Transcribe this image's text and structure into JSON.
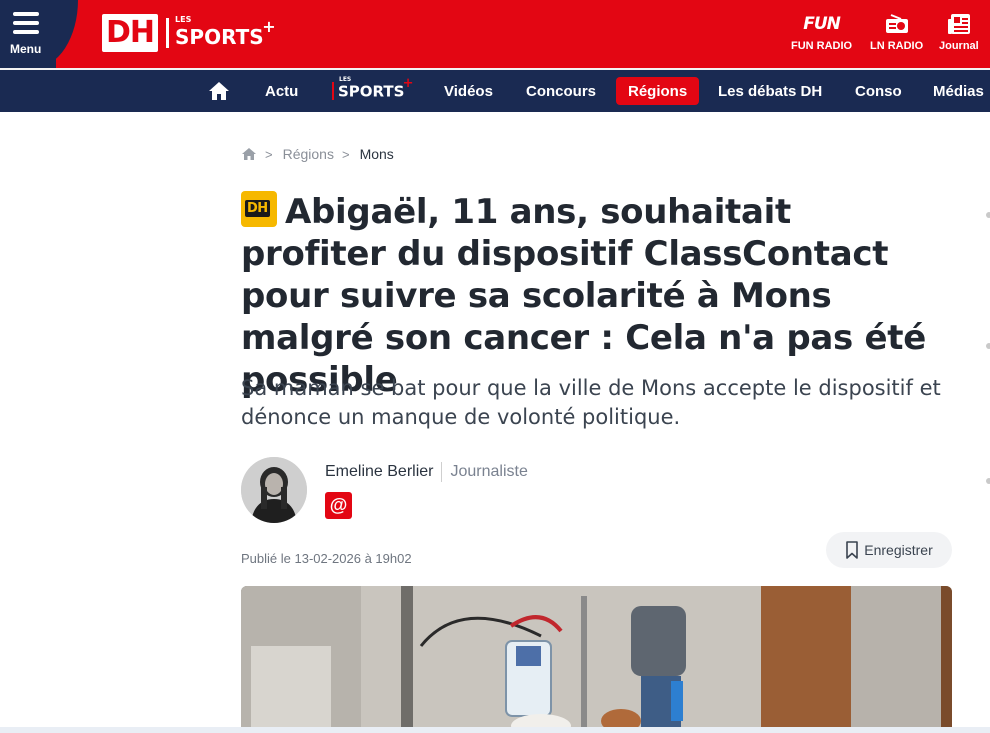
{
  "header": {
    "menu_label": "Menu",
    "logo_dh": "DH",
    "logo_les": "LES",
    "logo_sports": "SPORTS",
    "logo_plus": "+",
    "quick_links": [
      {
        "label": "FUN RADIO",
        "icon": "fun-radio-logo-icon",
        "icon_text": "FUN"
      },
      {
        "label": "LN RADIO",
        "icon": "radio-icon"
      },
      {
        "label": "Journal",
        "icon": "newspaper-icon"
      }
    ],
    "colors": {
      "brand_red": "#e30613",
      "navy": "#1a2a52",
      "badge_yellow": "#f6b800"
    }
  },
  "nav": {
    "items": [
      {
        "label": "Actu"
      },
      {
        "label": "SPORTS",
        "les": "LES",
        "plus": "+"
      },
      {
        "label": "Vidéos"
      },
      {
        "label": "Concours"
      },
      {
        "label": "Régions",
        "active": true
      },
      {
        "label": "Les débats DH"
      },
      {
        "label": "Conso"
      },
      {
        "label": "Médias"
      }
    ]
  },
  "breadcrumb": {
    "items": [
      "Régions",
      "Mons"
    ],
    "separator": ">"
  },
  "article": {
    "badge": "DH",
    "title": "Abigaël, 11 ans, souhaitait profiter du dispositif ClassContact pour suivre sa scolarité à Mons malgré son cancer : Cela n'a pas été possible",
    "subtitle": "Sa maman se bat pour que la ville de Mons accepte le dispositif et dénonce un manque de volonté politique.",
    "author": {
      "name": "Emeline Berlier",
      "role": "Journaliste",
      "contact_icon": "@"
    },
    "published": "Publié le 13-02-2026 à 19h02",
    "save_label": "Enregistrer"
  }
}
